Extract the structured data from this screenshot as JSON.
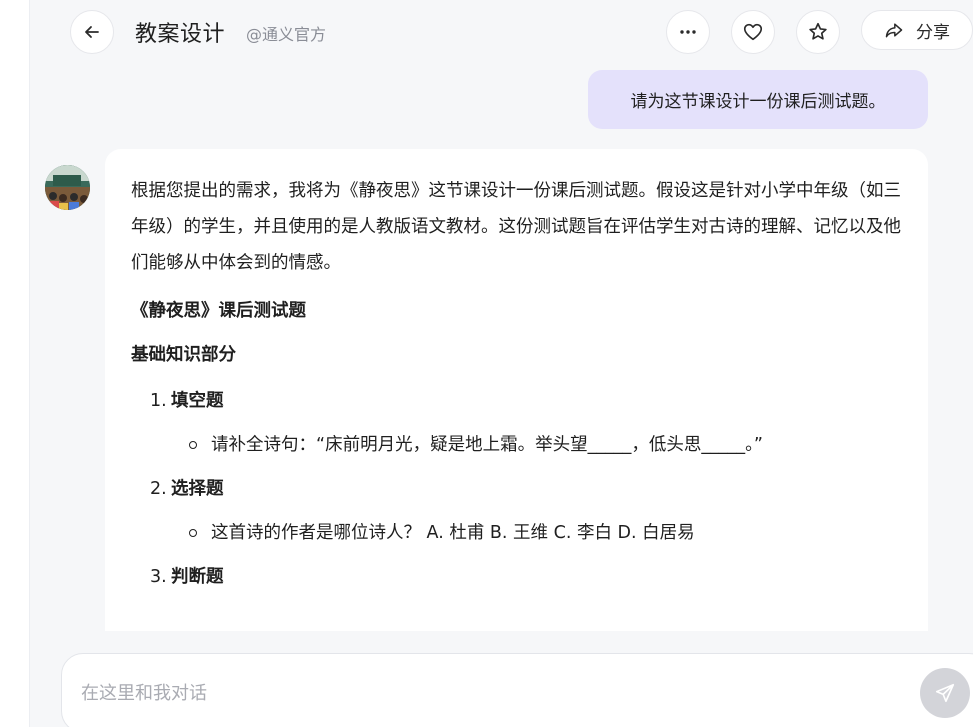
{
  "header": {
    "title": "教案设计",
    "author": "@通义官方",
    "share_label": "分享"
  },
  "user_message": "请为这节课设计一份课后测试题。",
  "answer": {
    "intro": "根据您提出的需求，我将为《静夜思》这节课设计一份课后测试题。假设这是针对小学中年级（如三年级）的学生，并且使用的是人教版语文教材。这份测试题旨在评估学生对古诗的理解、记忆以及他们能够从中体会到的情感。",
    "quiz_title": "《静夜思》课后测试题",
    "section_title": "基础知识部分",
    "items": [
      {
        "num": "1.",
        "label": "填空题",
        "sub": "请补全诗句：“床前明月光，疑是地上霜。举头望_____，低头思_____。”"
      },
      {
        "num": "2.",
        "label": "选择题",
        "sub": "这首诗的作者是哪位诗人？ A. 杜甫 B. 王维 C. 李白 D. 白居易"
      },
      {
        "num": "3.",
        "label": "判断题",
        "sub": ""
      }
    ]
  },
  "input": {
    "placeholder": "在这里和我对话",
    "value": ""
  },
  "icons": {
    "back": "arrow-left-icon",
    "more": "more-horizontal-icon",
    "like": "heart-icon",
    "favorite": "star-icon",
    "share": "share-arrow-icon",
    "send": "send-icon"
  },
  "colors": {
    "user_bubble": "#e4e1fb",
    "background": "#f6f7f9",
    "send_button": "#d3d4d9"
  }
}
